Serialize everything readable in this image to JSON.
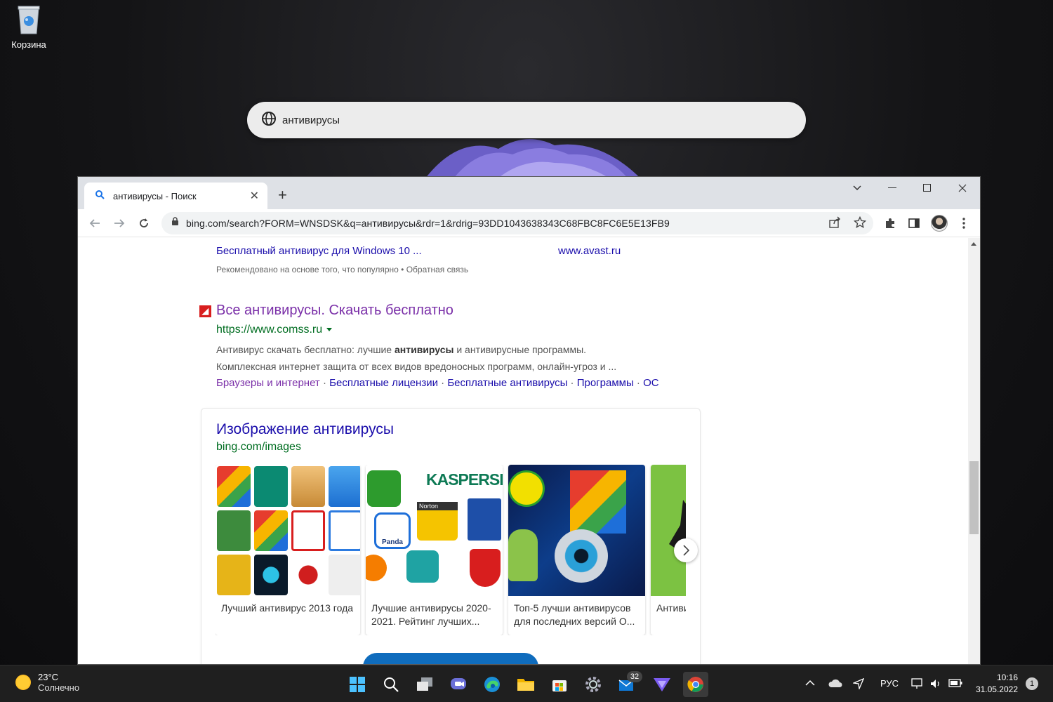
{
  "desktop": {
    "recycle_bin_label": "Корзина"
  },
  "windows_search": {
    "query": "антивирусы"
  },
  "browser": {
    "tab_title": "антивирусы - Поиск",
    "url": "bing.com/search?FORM=WNSDSK&q=антивирусы&rdr=1&rdrig=93DD1043638343C68FBC8FC6E5E13FB9"
  },
  "page": {
    "rec_left": "Бесплатный антивирус для Windows 10 ...",
    "rec_right": "www.avast.ru",
    "rec_note": "Рекомендовано на основе того, что популярно • Обратная связь",
    "result": {
      "title": "Все антивирусы. Скачать бесплатно",
      "url": "https://www.comss.ru",
      "snippet_line1_pre": "Антивирус скачать бесплатно: лучшие ",
      "snippet_line1_bold": "антивирусы",
      "snippet_line1_post": " и антивирусные программы.",
      "snippet_line2": "Комплексная интернет защита от всех видов вредоносных программ, онлайн-угроз и ...",
      "sitelinks": [
        "Браузеры и интернет",
        "Бесплатные лицензии",
        "Бесплатные антивирусы",
        "Программы",
        "ОС"
      ],
      "separator": " · "
    },
    "images": {
      "heading": "Изображение антивирусы",
      "source": "bing.com/images",
      "tiles": [
        {
          "caption": "Лучший антивирус 2013 года"
        },
        {
          "caption": "Лучшие антивирусы 2020-2021. Рейтинг лучших...",
          "brand": "KASPERSKY",
          "norton": "Norton",
          "panda": "Panda"
        },
        {
          "caption": "Топ-5 лучши антивирусов для последних версий О..."
        },
        {
          "caption": "Антиви"
        }
      ]
    }
  },
  "taskbar": {
    "temp": "23°C",
    "weather": "Солнечно",
    "badge_count": "32",
    "lang": "РУС",
    "time": "10:16",
    "date": "31.05.2022",
    "notifications": "1"
  }
}
